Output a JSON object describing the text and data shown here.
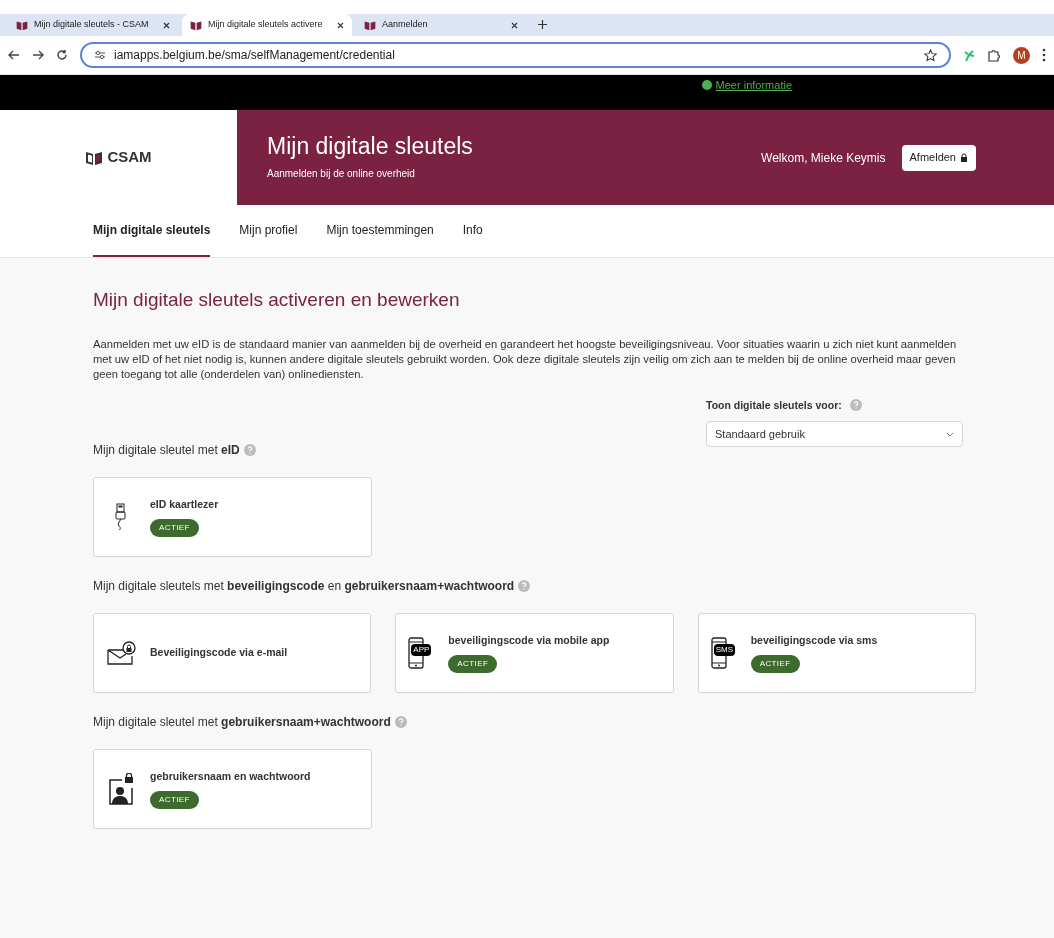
{
  "browser": {
    "tabs": [
      {
        "title": "Mijn digitale sleutels - CSAM",
        "selected": false
      },
      {
        "title": "Mijn digitale sleutels activere",
        "selected": true
      },
      {
        "title": "Aanmelden",
        "selected": false
      }
    ],
    "url": "iamapps.belgium.be/sma/selfManagement/credential",
    "profile_initial": "M"
  },
  "top_bar": {
    "link": "Meer informatie"
  },
  "header": {
    "logo": "CSAM",
    "title": "Mijn digitale sleutels",
    "subtitle": "Aanmelden bij de online overheid",
    "welcome": "Welkom, Mieke Keymis",
    "logout": "Afmelden"
  },
  "nav": [
    {
      "label": "Mijn digitale sleutels",
      "selected": true
    },
    {
      "label": "Mijn profiel",
      "selected": false
    },
    {
      "label": "Mijn toestemmingen",
      "selected": false
    },
    {
      "label": "Info",
      "selected": false
    }
  ],
  "page": {
    "heading": "Mijn digitale sleutels activeren en bewerken",
    "intro": "Aanmelden met uw eID is de standaard manier van aanmelden bij de overheid en garandeert het hoogste beveiligingsniveau. Voor situaties waarin u zich niet kunt aanmelden met uw eID of het niet nodig is, kunnen andere digitale sleutels gebruikt worden. Ook deze digitale sleutels zijn veilig om zich aan te melden bij de online overheid maar geven geen toegang tot alle (onderdelen van) onlinediensten.",
    "filter": {
      "label": "Toon digitale sleutels voor:",
      "value": "Standaard gebruik"
    }
  },
  "sections": [
    {
      "title": "Mijn digitale sleutel met **eID**",
      "cards": [
        {
          "kind": "reader",
          "title": "eID kaartlezer",
          "badge": "ACTIEF"
        }
      ]
    },
    {
      "title": "Mijn digitale sleutels met **beveiligingscode** en **gebruikersnaam+wachtwoord**",
      "cards": [
        {
          "kind": "email",
          "title": "Beveiligingscode via e-mail"
        },
        {
          "kind": "app",
          "icon_text": "APP",
          "title": "beveiligingscode via mobile app",
          "badge": "ACTIEF"
        },
        {
          "kind": "sms",
          "icon_text": "SMS",
          "title": "beveiligingscode via sms",
          "badge": "ACTIEF"
        }
      ]
    },
    {
      "title": "Mijn digitale sleutel met **gebruikersnaam+wachtwoord**",
      "cards": [
        {
          "kind": "user",
          "title": "gebruikersnaam en wachtwoord",
          "badge": "ACTIEF"
        }
      ]
    }
  ]
}
